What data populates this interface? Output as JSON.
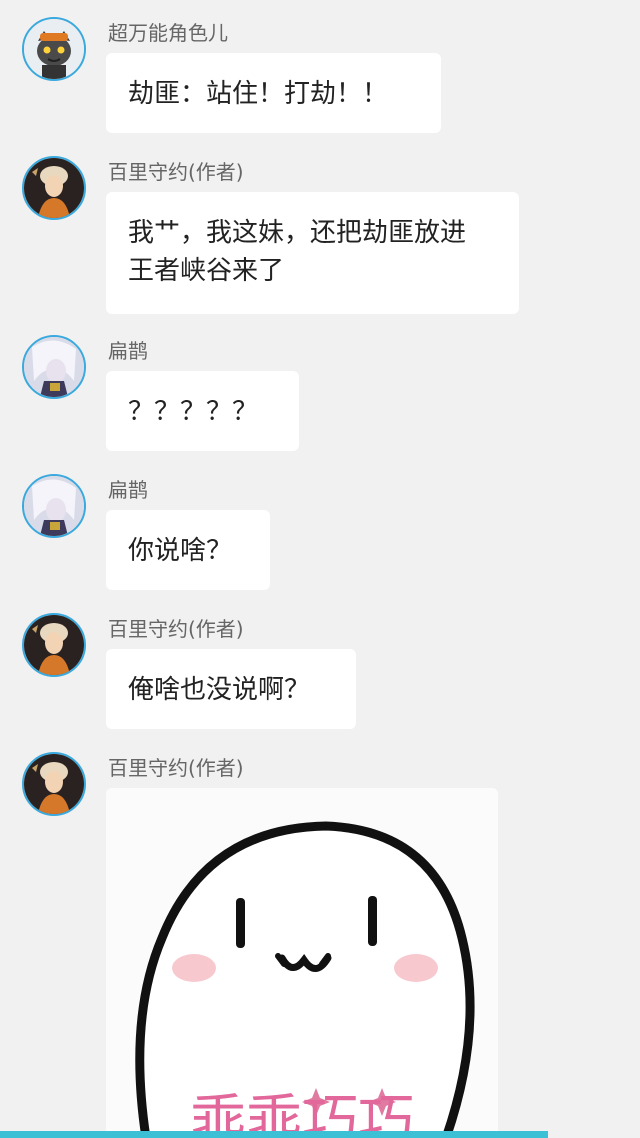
{
  "messages": [
    {
      "sender": "超万能角色儿",
      "avatar": "cat-avatar",
      "text": "劫匪：站住！打劫！！"
    },
    {
      "sender": "百里守约(作者)",
      "avatar": "hero-avatar",
      "text": "我艹，我这妹，还把劫匪放进王者峡谷来了"
    },
    {
      "sender": "扁鹊",
      "avatar": "white-hair-avatar",
      "text": "？？？？？"
    },
    {
      "sender": "扁鹊",
      "avatar": "white-hair-avatar",
      "text": "你说啥？"
    },
    {
      "sender": "百里守约(作者)",
      "avatar": "hero-avatar",
      "text": "俺啥也没说啊？"
    },
    {
      "sender": "百里守约(作者)",
      "avatar": "hero-avatar",
      "sticker": "meme-sticker",
      "sticker_caption": "乖乖巧巧"
    }
  ],
  "colors": {
    "avatar_border": "#3aa9de",
    "bottom_bar": "#3cc0d6",
    "background": "#f1f1f1"
  }
}
